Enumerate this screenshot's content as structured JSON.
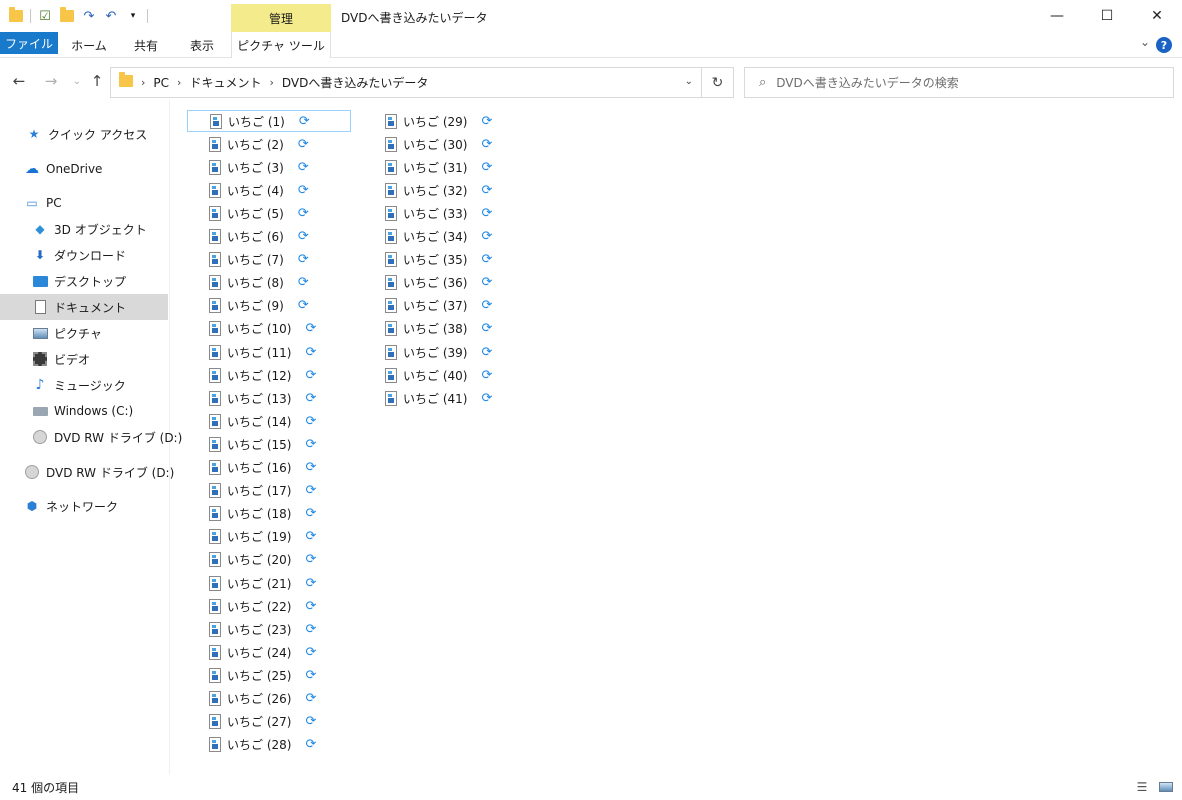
{
  "titlebar": {
    "title": "DVDへ書き込みたいデータ",
    "manage_tab": "管理",
    "controls": {
      "minimize": "—",
      "maximize": "☐",
      "close": "✕"
    }
  },
  "ribbon": {
    "tabs": [
      "ファイル",
      "ホーム",
      "共有",
      "表示",
      "ピクチャ ツール"
    ],
    "help": "?"
  },
  "address": {
    "crumbs": [
      "PC",
      "ドキュメント",
      "DVDへ書き込みたいデータ"
    ],
    "search_placeholder": "DVDへ書き込みたいデータの検索"
  },
  "sidebar": {
    "items": [
      {
        "label": "クイック アクセス",
        "icon": "star-icon"
      },
      {
        "label": "OneDrive",
        "icon": "cloud-icon"
      },
      {
        "label": "PC",
        "icon": "computer-icon"
      },
      {
        "label": "3D オブジェクト",
        "icon": "cube-icon"
      },
      {
        "label": "ダウンロード",
        "icon": "download-arrow-icon"
      },
      {
        "label": "デスクトップ",
        "icon": "desktop-icon"
      },
      {
        "label": "ドキュメント",
        "icon": "document-icon",
        "selected": true
      },
      {
        "label": "ピクチャ",
        "icon": "picture-icon"
      },
      {
        "label": "ビデオ",
        "icon": "video-icon"
      },
      {
        "label": "ミュージック",
        "icon": "music-note-icon"
      },
      {
        "label": "Windows (C:)",
        "icon": "drive-icon"
      },
      {
        "label": "DVD RW ドライブ (D:)",
        "icon": "disc-icon"
      },
      {
        "label": "DVD RW ドライブ (D:)",
        "icon": "disc-icon"
      },
      {
        "label": "ネットワーク",
        "icon": "network-icon"
      }
    ]
  },
  "files": [
    "いちご (1)",
    "いちご (2)",
    "いちご (3)",
    "いちご (4)",
    "いちご (5)",
    "いちご (6)",
    "いちご (7)",
    "いちご (8)",
    "いちご (9)",
    "いちご (10)",
    "いちご (11)",
    "いちご (12)",
    "いちご (13)",
    "いちご (14)",
    "いちご (15)",
    "いちご (16)",
    "いちご (17)",
    "いちご (18)",
    "いちご (19)",
    "いちご (20)",
    "いちご (21)",
    "いちご (22)",
    "いちご (23)",
    "いちご (24)",
    "いちご (25)",
    "いちご (26)",
    "いちご (27)",
    "いちご (28)",
    "いちご (29)",
    "いちご (30)",
    "いちご (31)",
    "いちご (32)",
    "いちご (33)",
    "いちご (34)",
    "いちご (35)",
    "いちご (36)",
    "いちご (37)",
    "いちご (38)",
    "いちご (39)",
    "いちご (40)",
    "いちご (41)"
  ],
  "status": {
    "count": "41 個の項目"
  },
  "colors": {
    "accent": "#1979ca",
    "manage": "#f4ec8c",
    "sync": "#1e88e5",
    "selection": "#d9d9d9"
  }
}
